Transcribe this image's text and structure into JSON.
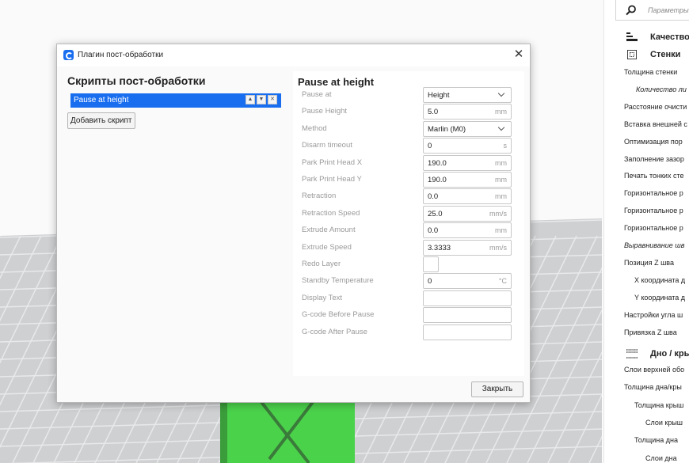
{
  "dialog": {
    "title": "Плагин пост-обработки",
    "left_heading": "Скрипты пост-обработки",
    "scripts": [
      {
        "label": "Pause at height"
      }
    ],
    "add_script_label": "Добавить скрипт",
    "close_label": "Закрыть"
  },
  "script_settings": {
    "heading": "Pause at height",
    "rows": [
      {
        "label": "Pause at",
        "value": "Height",
        "type": "select"
      },
      {
        "label": "Pause Height",
        "value": "5.0",
        "unit": "mm"
      },
      {
        "label": "Method",
        "value": "Marlin (M0)",
        "type": "select"
      },
      {
        "label": "Disarm timeout",
        "value": "0",
        "unit": "s"
      },
      {
        "label": "Park Print Head X",
        "value": "190.0",
        "unit": "mm"
      },
      {
        "label": "Park Print Head Y",
        "value": "190.0",
        "unit": "mm"
      },
      {
        "label": "Retraction",
        "value": "0.0",
        "unit": "mm"
      },
      {
        "label": "Retraction Speed",
        "value": "25.0",
        "unit": "mm/s"
      },
      {
        "label": "Extrude Amount",
        "value": "0.0",
        "unit": "mm"
      },
      {
        "label": "Extrude Speed",
        "value": "3.3333",
        "unit": "mm/s"
      },
      {
        "label": "Redo Layer",
        "value": "",
        "type": "checkbox"
      },
      {
        "label": "Standby Temperature",
        "value": "0",
        "unit": "°C"
      },
      {
        "label": "Display Text",
        "value": ""
      },
      {
        "label": "G-code Before Pause",
        "value": ""
      },
      {
        "label": "G-code After Pause",
        "value": ""
      }
    ]
  },
  "side_panel": {
    "search_placeholder": "Параметры",
    "sections": {
      "quality": "Качество",
      "walls": "Стенки",
      "top_bottom": "Дно / кры"
    },
    "settings": [
      "Толщина стенки",
      "Количество ли",
      "Расстояние очисти",
      "Вставка внешней с",
      "Оптимизация пор",
      "Заполнение зазор",
      "Печать тонких сте",
      "Горизонтальное р",
      "Горизонтальное р",
      "Горизонтальное р",
      "Выравнивание шв",
      "Позиция Z шва",
      "X координата д",
      "Y координата д",
      "Настройки угла ш",
      "Привязка Z шва"
    ],
    "settings_2": [
      "Слои верхней обо",
      "Толщина дна/кры",
      "Толщина крыш",
      "Слои крыш",
      "Толщина дна",
      "Слои дна"
    ]
  },
  "colors": {
    "accent": "#196ef0",
    "model": "#4bd24b"
  }
}
